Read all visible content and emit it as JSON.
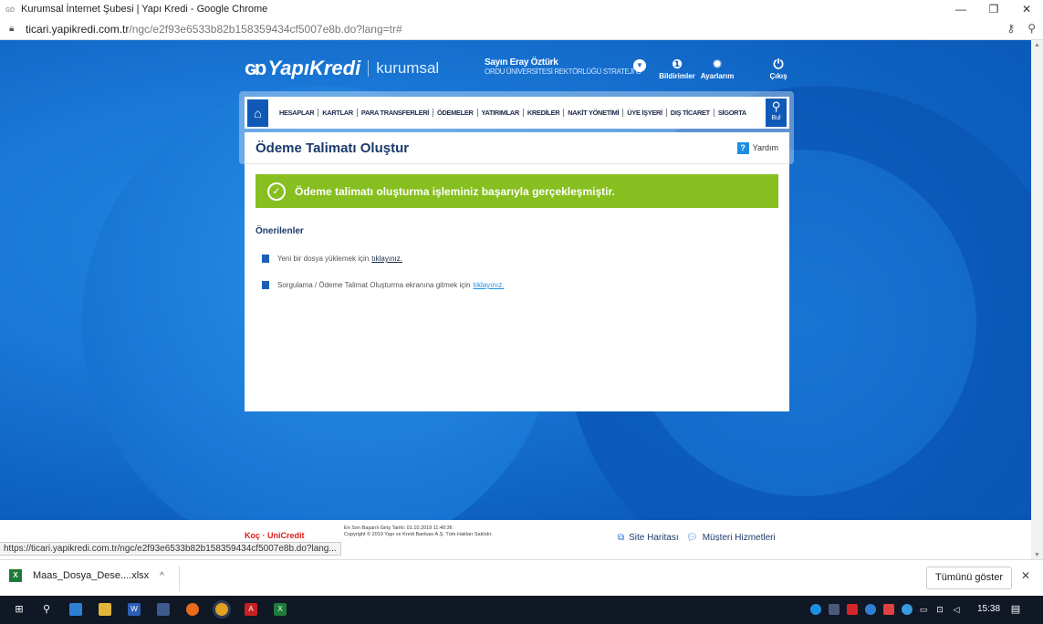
{
  "browser": {
    "title": "Kurumsal İnternet Şubesi | Yapı Kredi - Google Chrome",
    "url_host": "ticari.yapikredi.com.tr",
    "url_path": "/ngc/e2f93e6533b82b158359434cf5007e8b.do?lang=tr#",
    "status_url": "https://ticari.yapikredi.com.tr/ngc/e2f93e6533b82b158359434cf5007e8b.do?lang..."
  },
  "header": {
    "logo_mark": "ɢɒ",
    "logo_text": "YapıKredi",
    "kurumsal": "kurumsal",
    "user_name": "Sayın Eray Öztürk",
    "user_org": "ORDU ÜNİVERSİTESİ REKTÖRLÜĞÜ STRATEJİ G",
    "notifications_label": "Bildirimler",
    "settings_label": "Ayarlarım",
    "logout_label": "Çıkış"
  },
  "nav": {
    "items": [
      "HESAPLAR",
      "KARTLAR",
      "PARA TRANSFERLERİ",
      "ÖDEMELER",
      "YATIRIMLAR",
      "KREDİLER",
      "NAKİT YÖNETİMİ",
      "ÜYE İŞYERİ",
      "DIŞ TİCARET",
      "SİGORTA"
    ],
    "search_label": "Bul"
  },
  "panel": {
    "title": "Ödeme Talimatı Oluştur",
    "help_label": "Yardım",
    "success_message": "Ödeme talimatı oluşturma işleminiz başarıyla gerçekleşmiştir.",
    "suggestions_title": "Önerilenler",
    "suggestions": [
      {
        "text": "Yeni bir dosya yüklemek için",
        "link": "tıklayınız."
      },
      {
        "text": "Sorgulama / Ödeme Talimat Oluşturma ekranına gitmek için",
        "link": "tıklayınız."
      }
    ]
  },
  "footer": {
    "logos": "Koç · UniCredit",
    "last_login": "En Son Başarılı Giriş Tarihi: 01.10.2019 11:40:36",
    "copyright": "Copyright © 2019 Yapı ve Kredi Bankası A.Ş. Tüm Hakları Saklıdır.",
    "sitemap": "Site Haritası",
    "customer_service": "Müşteri Hizmetleri"
  },
  "downloads": {
    "file": "Maas_Dosya_Dese....xlsx",
    "show_all": "Tümünü göster"
  },
  "taskbar": {
    "time": "15:38"
  }
}
